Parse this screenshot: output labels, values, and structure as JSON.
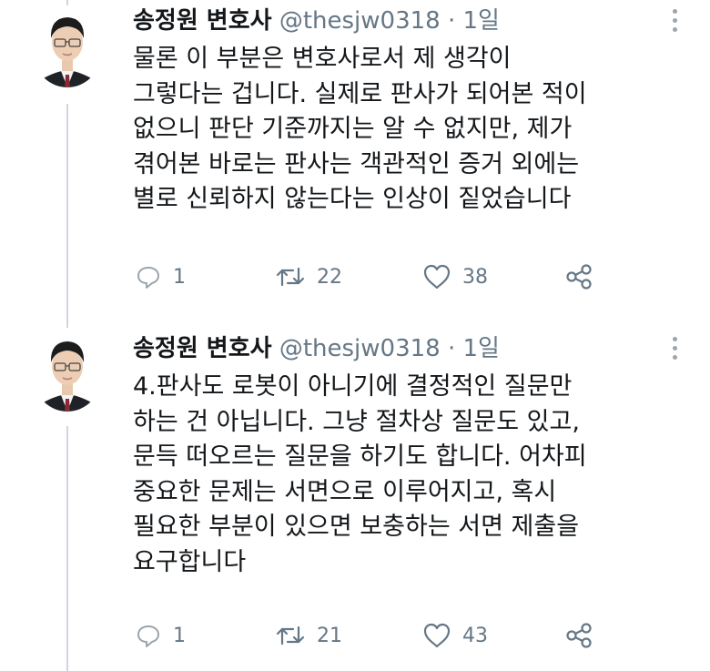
{
  "tweets": [
    {
      "author": "송정원 변호사",
      "handle": "@thesjw0318",
      "separator": "·",
      "time": "1일",
      "lines": [
        "물론 이 부분은 변호사로서 제 생각이",
        "그렇다는 겁니다. 실제로 판사가 되어본 적이",
        "없으니 판단 기준까지는 알 수 없지만, 제가",
        "겪어본 바로는 판사는 객관적인 증거 외에는",
        "별로 신뢰하지 않는다는 인상이 짙었습니다"
      ],
      "reply_count": "1",
      "retweet_count": "22",
      "like_count": "38"
    },
    {
      "author": "송정원 변호사",
      "handle": "@thesjw0318",
      "separator": "·",
      "time": "1일",
      "lines": [
        "4.판사도 로봇이 아니기에 결정적인 질문만",
        "하는 건 아닙니다. 그냥 절차상 질문도 있고,",
        "문득 떠오르는 질문을 하기도 합니다. 어차피",
        "중요한 문제는 서면으로 이루어지고, 혹시",
        "필요한 부분이 있으면 보충하는 서면 제출을",
        "요구합니다"
      ],
      "reply_count": "1",
      "retweet_count": "21",
      "like_count": "43"
    }
  ],
  "icons": {
    "reply": "reply-icon",
    "retweet": "retweet-icon",
    "like": "heart-icon",
    "share": "share-icon",
    "more": "more-options-icon"
  },
  "colors": {
    "text": "#14171a",
    "secondary": "#657786",
    "thread_line": "#cfd6dc",
    "background": "#ffffff"
  }
}
